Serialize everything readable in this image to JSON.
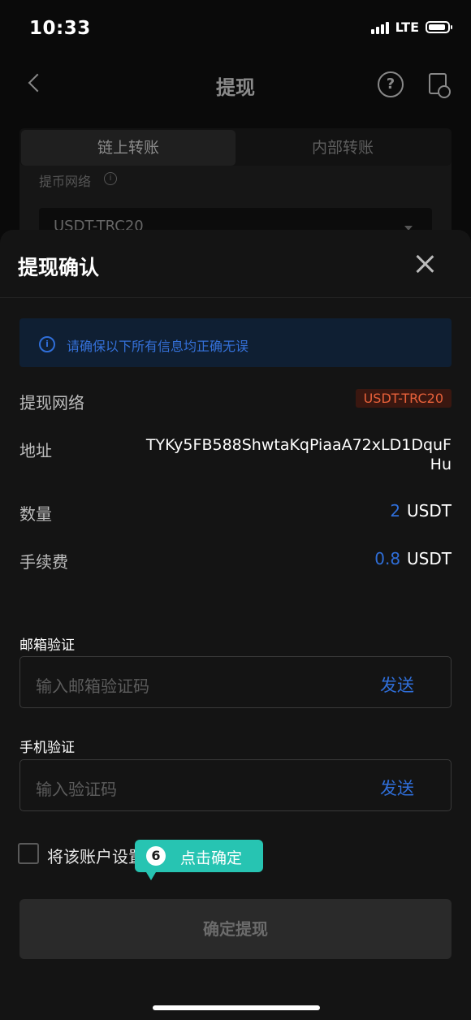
{
  "status": {
    "time": "10:33",
    "network": "LTE"
  },
  "nav": {
    "title": "提现"
  },
  "background_form": {
    "tabs": [
      "链上转账",
      "内部转账"
    ],
    "network_label": "提币网络",
    "network_value": "USDT-TRC20"
  },
  "sheet": {
    "title": "提现确认",
    "notice": "请确保以下所有信息均正确无误",
    "rows": {
      "network_label": "提现网络",
      "network_value": "USDT-TRC20",
      "address_label": "地址",
      "address_value": "TYKy5FB588ShwtaKqPiaaA72xLD1DquFHu",
      "amount_label": "数量",
      "amount_value": "2",
      "amount_unit": "USDT",
      "fee_label": "手续费",
      "fee_value": "0.8",
      "fee_unit": "USDT"
    },
    "email": {
      "label": "邮箱验证",
      "placeholder": "输入邮箱验证码",
      "send": "发送"
    },
    "phone": {
      "label": "手机验证",
      "placeholder": "输入验证码",
      "send": "发送"
    },
    "checkbox_label": "将该账户设置",
    "tooltip": {
      "step": "6",
      "text": "点击确定"
    },
    "confirm_label": "确定提现"
  },
  "colors": {
    "accent": "#2f6ed8",
    "tooltip": "#27c4b2",
    "badge_text": "#e8613a"
  }
}
